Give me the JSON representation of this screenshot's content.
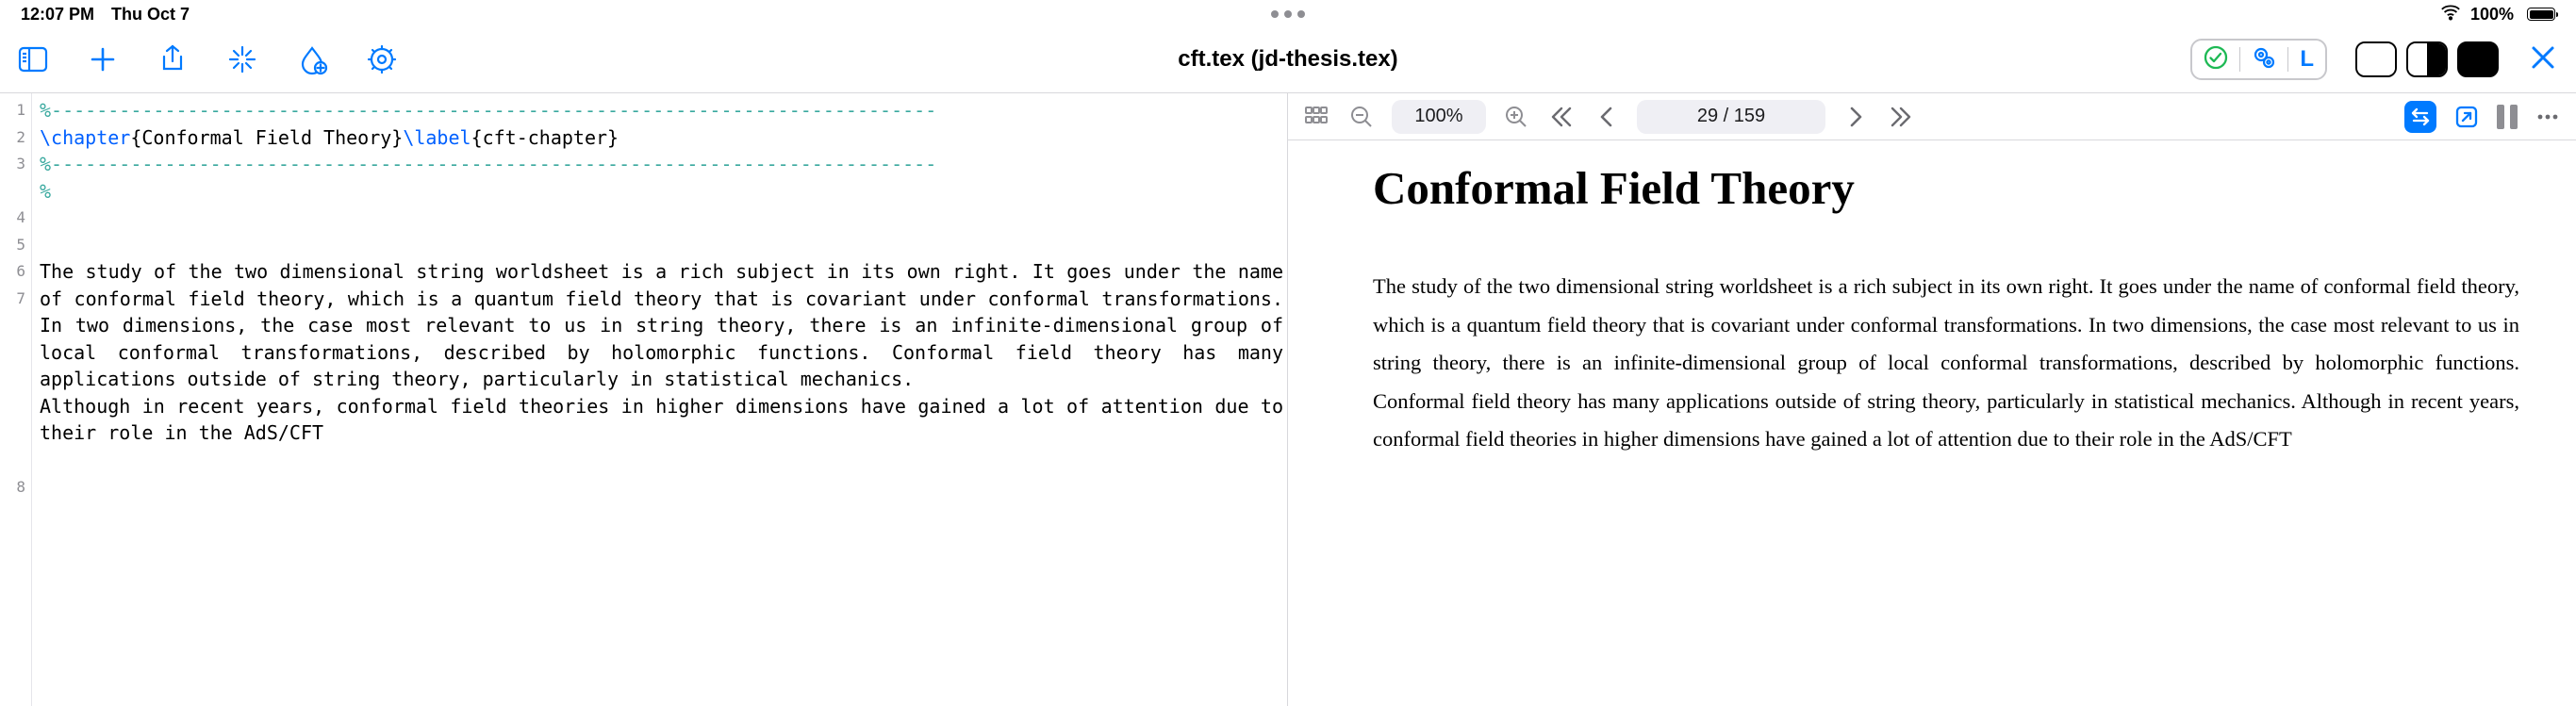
{
  "status": {
    "time": "12:07 PM",
    "date": "Thu Oct 7",
    "battery_pct": "100%"
  },
  "toolbar": {
    "title": "cft.tex (jd-thesis.tex)",
    "status_letter": "L"
  },
  "editor": {
    "lines": {
      "l1": "%------------------------------------------------------------------------------",
      "l2a": "\\chapter",
      "l2b": "{Conformal Field Theory}",
      "l2c": "\\label",
      "l2d": "{cft-chapter}",
      "l3": "%------------------------------------------------------------------------------",
      "l4": "%",
      "l5": "",
      "l6": "",
      "l7": "The study of the two dimensional string worldsheet is a rich subject in its own right. It goes under the name of conformal field theory, which is a quantum field theory that is covariant under conformal transformations. In two dimensions, the case most relevant to us in string theory, there is an infinite-dimensional group of local conformal transformations, described by holomorphic functions. Conformal field theory has many applications outside of string theory, particularly in statistical mechanics.",
      "l8": "Although in recent years, conformal field theories in higher dimensions have gained a lot of attention due to their role in the AdS/CFT"
    },
    "linenums": [
      "1",
      "2",
      "3",
      "4",
      "5",
      "6",
      "7",
      "8"
    ]
  },
  "preview": {
    "zoom": "100%",
    "page": "29 / 159",
    "heading": "Conformal Field Theory",
    "para": "The study of the two dimensional string worldsheet is a rich subject in its own right. It goes under the name of conformal field theory, which is a quantum field theory that is covariant under conformal transformations. In two dimensions, the case most relevant to us in string theory, there is an infinite-dimensional group of local conformal transformations, described by holomorphic functions. Conformal field theory has many applications outside of string theory, particularly in statistical mechanics. Although in recent years, conformal field theories in higher dimensions have gained a lot of attention due to their role in the AdS/CFT"
  }
}
